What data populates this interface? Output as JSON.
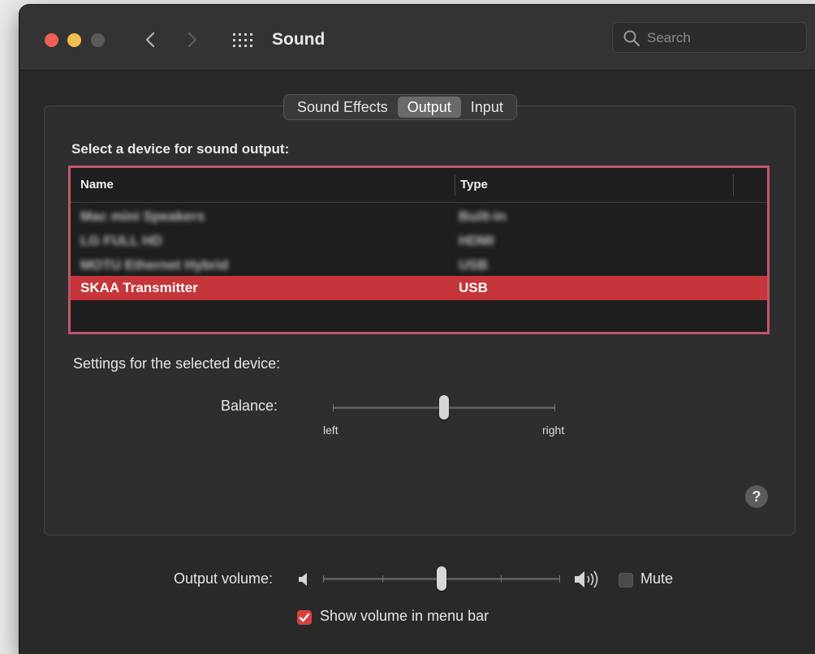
{
  "window": {
    "title": "Sound",
    "search_placeholder": "Search"
  },
  "tabs": [
    {
      "label": "Sound Effects",
      "active": false
    },
    {
      "label": "Output",
      "active": true
    },
    {
      "label": "Input",
      "active": false
    }
  ],
  "output": {
    "section_label": "Select a device for sound output:",
    "columns": [
      "Name",
      "Type"
    ],
    "devices": [
      {
        "name": "Mac mini Speakers",
        "type": "Built-in",
        "redacted": true
      },
      {
        "name": "LG FULL HD",
        "type": "HDMI",
        "redacted": true
      },
      {
        "name": "MOTU Ethernet Hybrid",
        "type": "USB",
        "redacted": true
      },
      {
        "name": "SKAA Transmitter",
        "type": "USB",
        "selected": true
      }
    ],
    "selection_color": "#c5353a",
    "highlight_border_color": "#c0566a"
  },
  "settings": {
    "label": "Settings for the selected device:",
    "balance_label": "Balance:",
    "balance_left": "left",
    "balance_right": "right",
    "balance_value": 0.5
  },
  "help_label": "?",
  "volume": {
    "label": "Output volume:",
    "value": 0.5,
    "mute_label": "Mute",
    "mute_checked": false,
    "show_in_menu_bar_label": "Show volume in menu bar",
    "show_in_menu_bar_checked": true
  },
  "icons": {
    "back": "chevron-left-icon",
    "forward": "chevron-right-icon",
    "grid": "grid-icon",
    "search": "search-icon",
    "speaker_low": "speaker-low-icon",
    "speaker_high": "speaker-high-icon",
    "help": "help-icon",
    "check": "check-icon"
  }
}
